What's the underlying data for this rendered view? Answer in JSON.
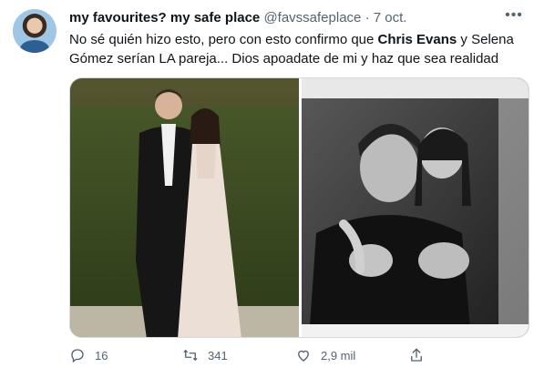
{
  "tweet": {
    "display_name": "my favourites? my safe place",
    "handle": "@favssafeplace",
    "separator": "·",
    "date": "7 oct.",
    "text_part1": "No sé quién hizo esto, pero con esto confirmo que ",
    "text_bold": "Chris Evans",
    "text_part2": " y Selena Gómez serían LA pareja... Dios apoadate de mi y haz que sea realidad"
  },
  "actions": {
    "replies": "16",
    "retweets": "341",
    "likes": "2,9 mil"
  },
  "icons": {
    "avatar": "profile-avatar",
    "more": "more-options-icon",
    "reply": "reply-icon",
    "retweet": "retweet-icon",
    "like": "heart-icon",
    "share": "share-icon"
  },
  "colors": {
    "text": "#0f1419",
    "secondary": "#536471",
    "border": "#cfd9de"
  }
}
